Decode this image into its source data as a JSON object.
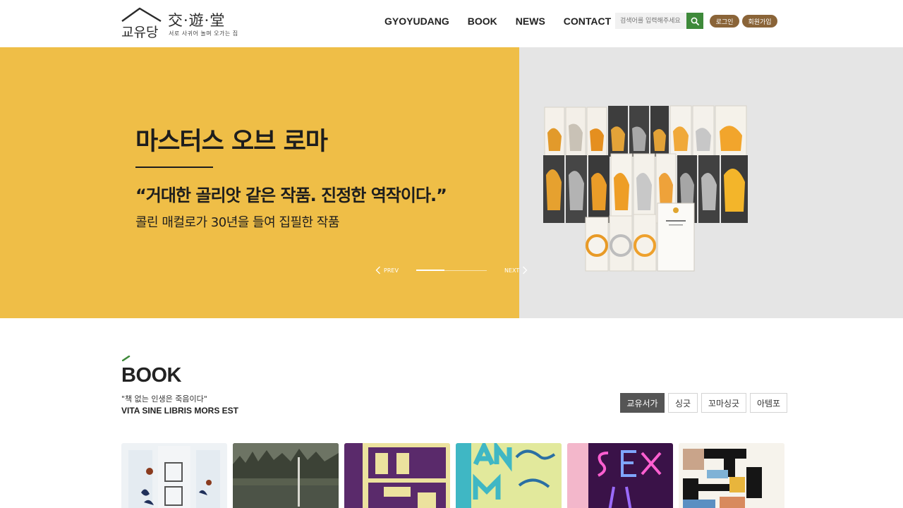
{
  "header": {
    "logo_text": "교유당",
    "logo_hanja": "交·遊·堂",
    "logo_tagline": "서로 사귀어 놀며 오가는 집",
    "nav": [
      "GYOYUDANG",
      "BOOK",
      "NEWS",
      "CONTACT"
    ],
    "search_placeholder": "검색어를 입력해주세요",
    "login_label": "로그인",
    "join_label": "회원가입"
  },
  "hero": {
    "title": "마스터스 오브 로마",
    "quote": "“거대한 골리앗 같은 작품. 진정한 역작이다.”",
    "subtitle": "콜린 매컬로가 30년을 들여 집필한 작품",
    "prev_label": "PREV",
    "next_label": "NEXT",
    "progress": 0.4,
    "colors": {
      "left_bg": "#efbe47",
      "right_bg": "#e5e5e5"
    }
  },
  "book_section": {
    "title": "BOOK",
    "quote": "\"책 없는 인생은 죽음이다\"",
    "latin": "VITA SINE LIBRIS MORS EST",
    "tabs": [
      "교유서가",
      "싱긋",
      "꼬마싱긋",
      "아템포"
    ],
    "active_tab": 0
  },
  "colors": {
    "accent_green": "#3e8a3a",
    "pill_brown": "#8a6438"
  }
}
